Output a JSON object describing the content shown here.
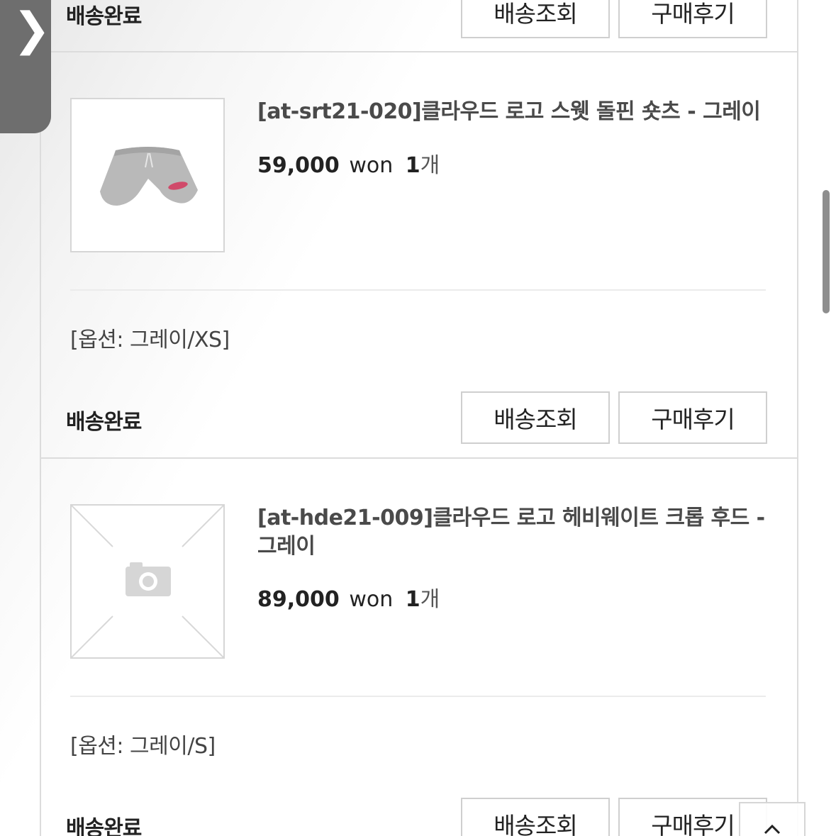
{
  "nav": {
    "side_tab_glyph": "❯"
  },
  "orders": [
    {
      "status": "배송완료",
      "buttons": {
        "track": "배송조회",
        "review": "구매후기"
      }
    },
    {
      "product_name": "[at-srt21-020]클라우드 로고 스웻 돌핀 숏츠 - 그레이",
      "price": "59,000",
      "currency": "won",
      "qty_num": "1",
      "qty_unit": "개",
      "option": "[옵션: 그레이/XS]",
      "status": "배송완료",
      "buttons": {
        "track": "배송조회",
        "review": "구매후기"
      },
      "image": "gray-shorts-photo"
    },
    {
      "product_name": "[at-hde21-009]클라우드 로고 헤비웨이트 크롭 후드 - 그레이",
      "price": "89,000",
      "currency": "won",
      "qty_num": "1",
      "qty_unit": "개",
      "option": "[옵션: 그레이/S]",
      "status": "배송완료",
      "buttons": {
        "track": "배송조회",
        "review": "구매후기"
      },
      "image": "no-image-placeholder"
    }
  ],
  "colors": {
    "side_tab": "#6e6e6e",
    "border": "#dcdcdc",
    "text": "#222222",
    "product_name": "#4a4a4a"
  }
}
